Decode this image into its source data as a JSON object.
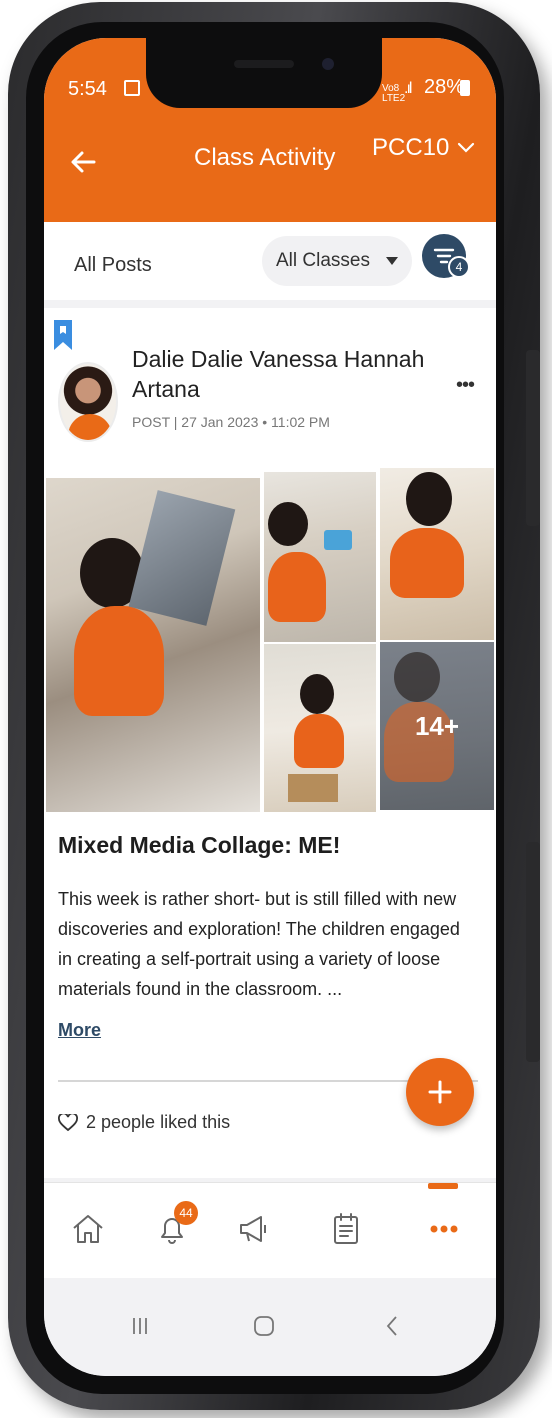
{
  "status_bar": {
    "time": "5:54",
    "network_label": "Vo8\nLTE2",
    "battery": "28%"
  },
  "header": {
    "title": "Class Activity",
    "class_selector": "PCC10",
    "accent_color": "#e96a17"
  },
  "filter_bar": {
    "posts_filter": "All Posts",
    "class_filter": "All Classes",
    "filter_count": "4"
  },
  "post": {
    "author": "Dalie Dalie Vanessa Hannah Artana",
    "meta": "POST | 27 Jan 2023 • 11:02 PM",
    "more_photos": "14+",
    "title": "Mixed Media Collage: ME!",
    "body": "This week is rather short- but is still filled with new discoveries and exploration! The children engaged in creating a self-portrait using a variety of loose materials found in the classroom. ...",
    "more_label": "More",
    "likes": "2 people liked this"
  },
  "bottom_nav": {
    "items": [
      "home-icon",
      "bell-icon",
      "megaphone-icon",
      "calendar-icon",
      "more-icon"
    ],
    "notification_count": "44",
    "active": "more-icon"
  }
}
